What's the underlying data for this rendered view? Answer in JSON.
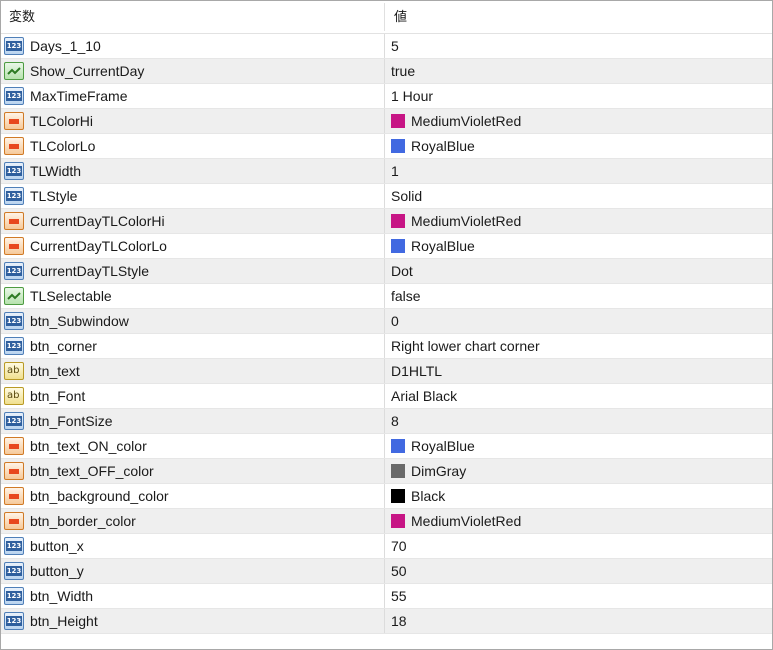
{
  "header": {
    "variable": "変数",
    "value": "値"
  },
  "rows": [
    {
      "name": "Days_1_10",
      "icon": "int-icon",
      "value": "5"
    },
    {
      "name": "Show_CurrentDay",
      "icon": "bool-icon",
      "value": "true"
    },
    {
      "name": "MaxTimeFrame",
      "icon": "int-icon",
      "value": "1 Hour"
    },
    {
      "name": "TLColorHi",
      "icon": "color-icon",
      "value": "MediumVioletRed",
      "color": "#C71585"
    },
    {
      "name": "TLColorLo",
      "icon": "color-icon",
      "value": "RoyalBlue",
      "color": "#4169E1"
    },
    {
      "name": "TLWidth",
      "icon": "int-icon",
      "value": "1"
    },
    {
      "name": "TLStyle",
      "icon": "int-icon",
      "value": "Solid"
    },
    {
      "name": "CurrentDayTLColorHi",
      "icon": "color-icon",
      "value": "MediumVioletRed",
      "color": "#C71585"
    },
    {
      "name": "CurrentDayTLColorLo",
      "icon": "color-icon",
      "value": "RoyalBlue",
      "color": "#4169E1"
    },
    {
      "name": "CurrentDayTLStyle",
      "icon": "int-icon",
      "value": "Dot"
    },
    {
      "name": "TLSelectable",
      "icon": "bool-icon",
      "value": "false"
    },
    {
      "name": "btn_Subwindow",
      "icon": "int-icon",
      "value": "0"
    },
    {
      "name": "btn_corner",
      "icon": "int-icon",
      "value": "Right lower chart corner"
    },
    {
      "name": "btn_text",
      "icon": "string-icon",
      "value": "D1HLTL"
    },
    {
      "name": "btn_Font",
      "icon": "string-icon",
      "value": "Arial Black"
    },
    {
      "name": "btn_FontSize",
      "icon": "int-icon",
      "value": "8"
    },
    {
      "name": "btn_text_ON_color",
      "icon": "color-icon",
      "value": "RoyalBlue",
      "color": "#4169E1"
    },
    {
      "name": "btn_text_OFF_color",
      "icon": "color-icon",
      "value": "DimGray",
      "color": "#696969"
    },
    {
      "name": "btn_background_color",
      "icon": "color-icon",
      "value": "Black",
      "color": "#000000"
    },
    {
      "name": "btn_border_color",
      "icon": "color-icon",
      "value": "MediumVioletRed",
      "color": "#C71585"
    },
    {
      "name": "button_x",
      "icon": "int-icon",
      "value": "70"
    },
    {
      "name": "button_y",
      "icon": "int-icon",
      "value": "50"
    },
    {
      "name": "btn_Width",
      "icon": "int-icon",
      "value": "55"
    },
    {
      "name": "btn_Height",
      "icon": "int-icon",
      "value": "18"
    }
  ],
  "icon_text": {
    "int": "123",
    "string": "ab"
  }
}
